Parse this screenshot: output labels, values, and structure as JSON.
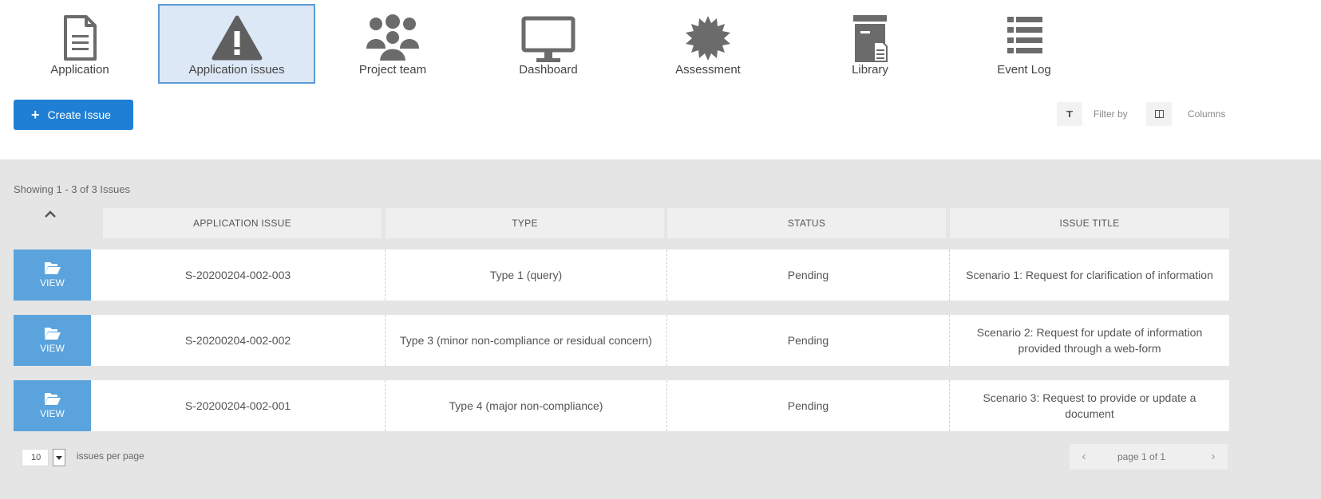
{
  "nav": {
    "items": [
      {
        "label": "Application",
        "icon": "document-icon"
      },
      {
        "label": "Application issues",
        "icon": "warning-icon"
      },
      {
        "label": "Project team",
        "icon": "team-icon"
      },
      {
        "label": "Dashboard",
        "icon": "monitor-icon"
      },
      {
        "label": "Assessment",
        "icon": "badge-icon"
      },
      {
        "label": "Library",
        "icon": "archive-icon"
      },
      {
        "label": "Event Log",
        "icon": "list-icon"
      }
    ],
    "active_index": 1
  },
  "toolbar": {
    "create_label": "Create Issue",
    "filter_label": "Filter by",
    "columns_label": "Columns"
  },
  "table": {
    "showing_text": "Showing 1 - 3 of 3 Issues",
    "columns": [
      "APPLICATION ISSUE",
      "TYPE",
      "STATUS",
      "ISSUE TITLE"
    ],
    "view_label": "VIEW",
    "rows": [
      {
        "issue": "S-20200204-002-003",
        "type": "Type 1 (query)",
        "status": "Pending",
        "title": "Scenario 1: Request for clarification of information"
      },
      {
        "issue": "S-20200204-002-002",
        "type": "Type 3 (minor non-compliance or residual concern)",
        "status": "Pending",
        "title": "Scenario 2: Request for update of information provided through a web-form"
      },
      {
        "issue": "S-20200204-002-001",
        "type": "Type 4 (major non-compliance)",
        "status": "Pending",
        "title": "Scenario 3: Request to provide or update a document"
      }
    ]
  },
  "footer": {
    "per_page_value": "10",
    "per_page_label": "issues per page",
    "page_text": "page 1 of 1"
  },
  "colors": {
    "accent": "#1f7fd4",
    "view_button": "#5aa3dc",
    "active_nav_bg": "#dce8f6",
    "active_nav_border": "#5b9bd5",
    "icon": "#6b6b6b",
    "panel_bg": "#e5e5e5"
  }
}
